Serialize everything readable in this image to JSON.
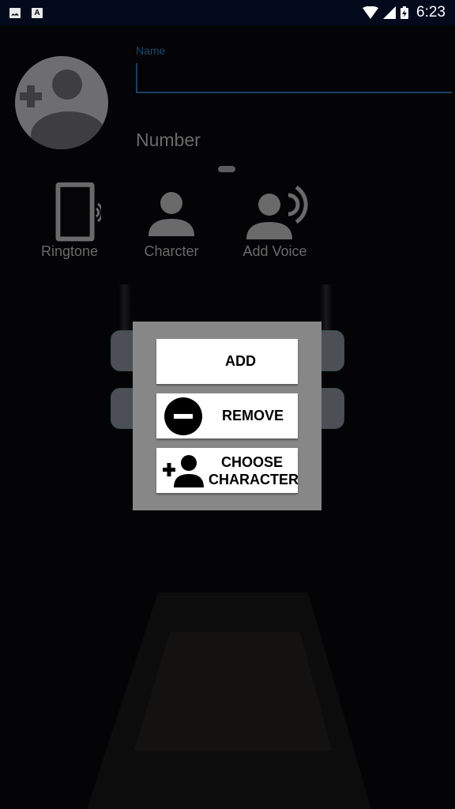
{
  "status_bar": {
    "left_icons": [
      "image-icon",
      "font-icon"
    ],
    "right_icons": [
      "wifi-icon",
      "signal-icon",
      "battery-charging-icon"
    ],
    "time": "6:23",
    "font_icon_glyph": "A"
  },
  "form": {
    "avatar_icon": "add-contact-icon",
    "name_label": "Name",
    "name_value": "",
    "number_label": "Number",
    "accent_color": "#1a3e63"
  },
  "options": [
    {
      "label": "Ringtone",
      "icon": "ringtone-icon"
    },
    {
      "label": "Charcter",
      "icon": "person-icon"
    },
    {
      "label": "Add Voice",
      "icon": "voice-icon"
    }
  ],
  "dialog": {
    "buttons": [
      {
        "label": "ADD",
        "icon": null
      },
      {
        "label": "REMOVE",
        "icon": "remove-circle-icon"
      },
      {
        "label_line1": "CHOOSE",
        "label_line2": "CHARACTER",
        "icon": "add-person-icon"
      }
    ],
    "background_color": "#878787"
  }
}
